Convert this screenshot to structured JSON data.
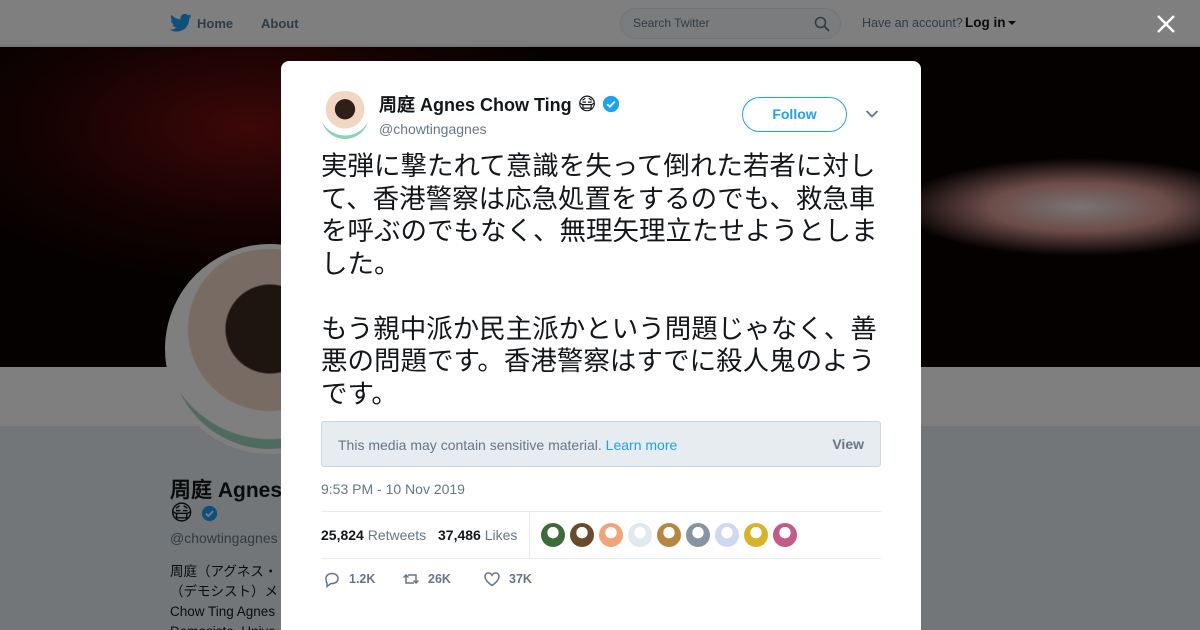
{
  "nav": {
    "home_label": "Home",
    "about_label": "About",
    "search_placeholder": "Search Twitter",
    "account_prompt": "Have an account?",
    "login_label": "Log in"
  },
  "profile": {
    "name": "周庭 Agnes",
    "emoji": "😷",
    "handle": "@chowtingagnes",
    "bio": "周庭（アグネス・\n（デモシスト）メ\nChow Ting Agnes\nDemosisto. Unive"
  },
  "tweet": {
    "author_name": "周庭 Agnes Chow Ting",
    "author_emoji": "😷",
    "handle": "@chowtingagnes",
    "follow_label": "Follow",
    "text": "実弾に撃たれて意識を失って倒れた若者に対して、香港警察は応急処置をするのでも、救急車を呼ぶのでもなく、無理矢理立たせようとしました。\n\nもう親中派か民主派かという問題じゃなく、善悪の問題です。香港警察はすでに殺人鬼のようです。",
    "sensitive_notice": "This media may contain sensitive material.",
    "learn_more_label": "Learn more",
    "view_label": "View",
    "timestamp": "9:53 PM - 10 Nov 2019",
    "retweets_count": "25,824",
    "retweets_label": "Retweets",
    "likes_count": "37,486",
    "likes_label": "Likes",
    "reply_count": "1.2K",
    "retweet_action_count": "26K",
    "like_action_count": "37K"
  },
  "liker_avatars": [
    "#3f6b3a",
    "#6b4a2a",
    "#f2a57a",
    "#dfe9ef",
    "#b88640",
    "#8795a3",
    "#cfd8f0",
    "#d8b32a",
    "#c45a8a"
  ],
  "colors": {
    "accent": "#1da1f2",
    "text_primary": "#14171a",
    "text_secondary": "#657786"
  }
}
